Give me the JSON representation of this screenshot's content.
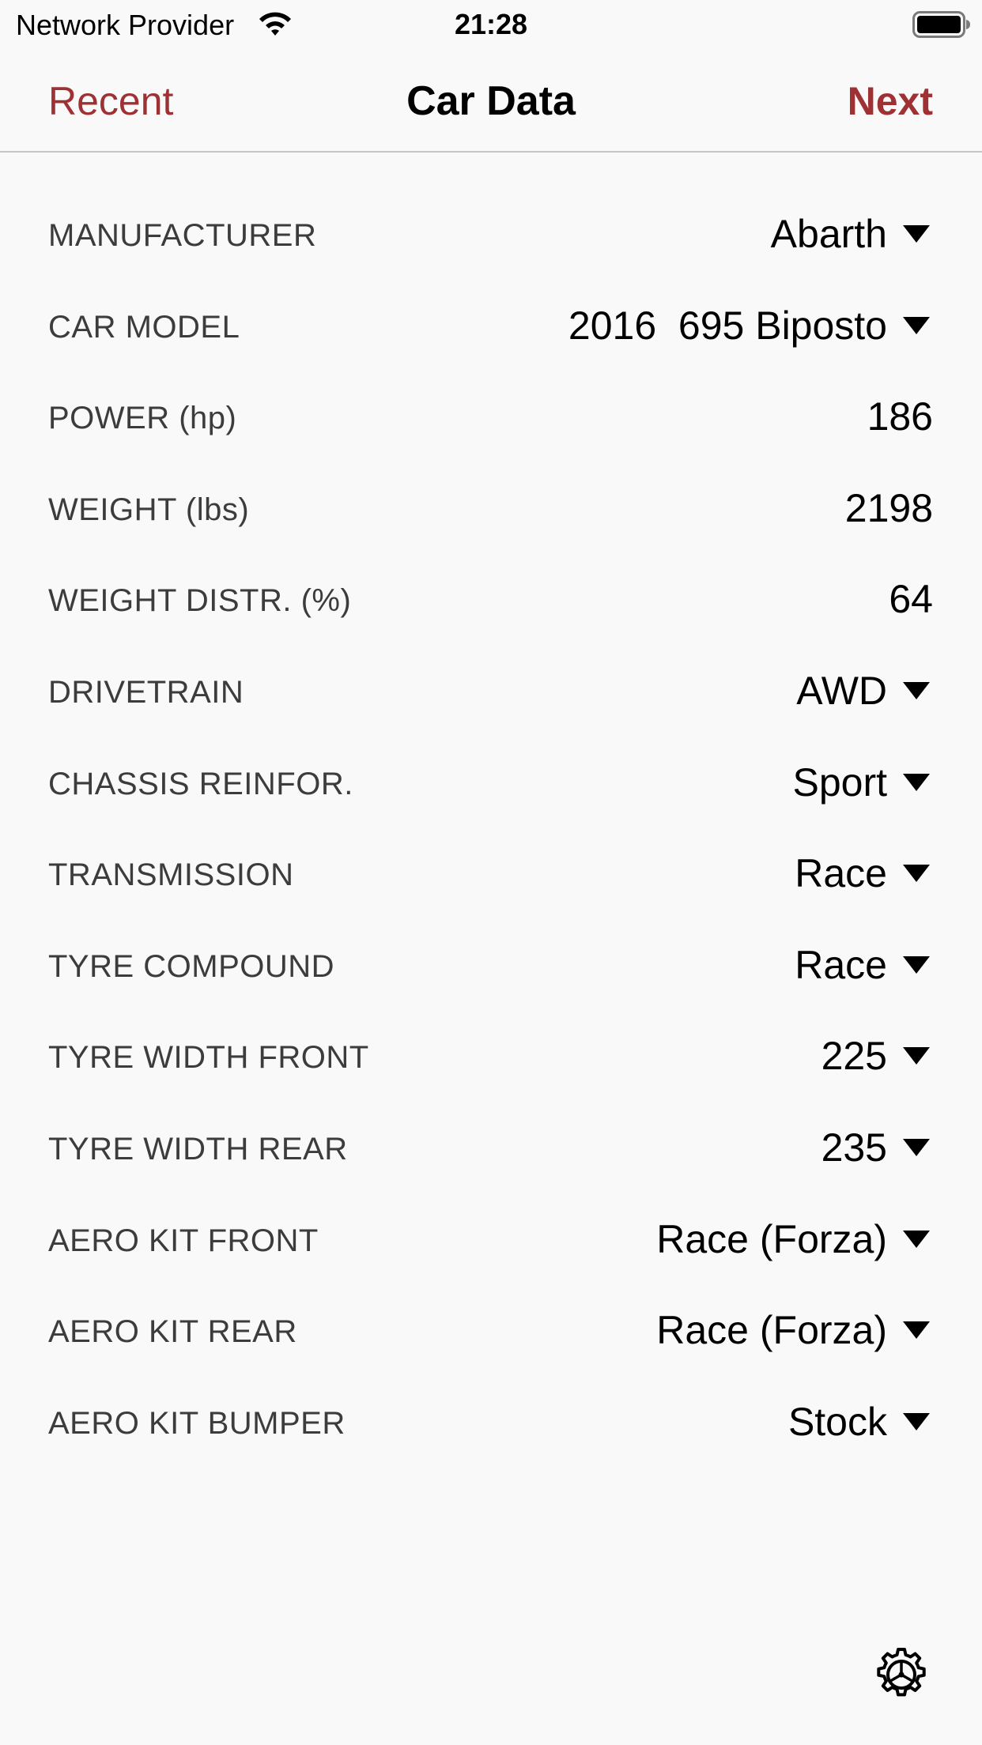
{
  "status_bar": {
    "carrier": "Network Provider",
    "time": "21:28",
    "wifi_icon": "wifi-icon",
    "battery_icon": "battery-full-icon"
  },
  "nav": {
    "left_label": "Recent",
    "title": "Car Data",
    "right_label": "Next",
    "accent_color": "#9e3134"
  },
  "fields": {
    "manufacturer": {
      "label": "MANUFACTURER",
      "value": "Abarth"
    },
    "car_model": {
      "label": "CAR MODEL",
      "value": "2016  695 Biposto"
    },
    "power": {
      "label": "POWER (hp)",
      "value": "186"
    },
    "weight": {
      "label": "WEIGHT (lbs)",
      "value": "2198"
    },
    "weight_distr": {
      "label": "WEIGHT DISTR. (%)",
      "value": "64"
    },
    "drivetrain": {
      "label": "DRIVETRAIN",
      "value": "AWD"
    },
    "chassis_reinfor": {
      "label": "CHASSIS REINFOR.",
      "value": "Sport"
    },
    "transmission": {
      "label": "TRANSMISSION",
      "value": "Race"
    },
    "tyre_compound": {
      "label": "TYRE COMPOUND",
      "value": "Race"
    },
    "tyre_width_front": {
      "label": "TYRE WIDTH FRONT",
      "value": "225"
    },
    "tyre_width_rear": {
      "label": "TYRE WIDTH REAR",
      "value": "235"
    },
    "aero_kit_front": {
      "label": "AERO KIT FRONT",
      "value": "Race (Forza)"
    },
    "aero_kit_rear": {
      "label": "AERO KIT REAR",
      "value": "Race (Forza)"
    },
    "aero_kit_bumper": {
      "label": "AERO KIT BUMPER",
      "value": "Stock"
    }
  },
  "footer": {
    "settings_icon": "gear-icon"
  }
}
